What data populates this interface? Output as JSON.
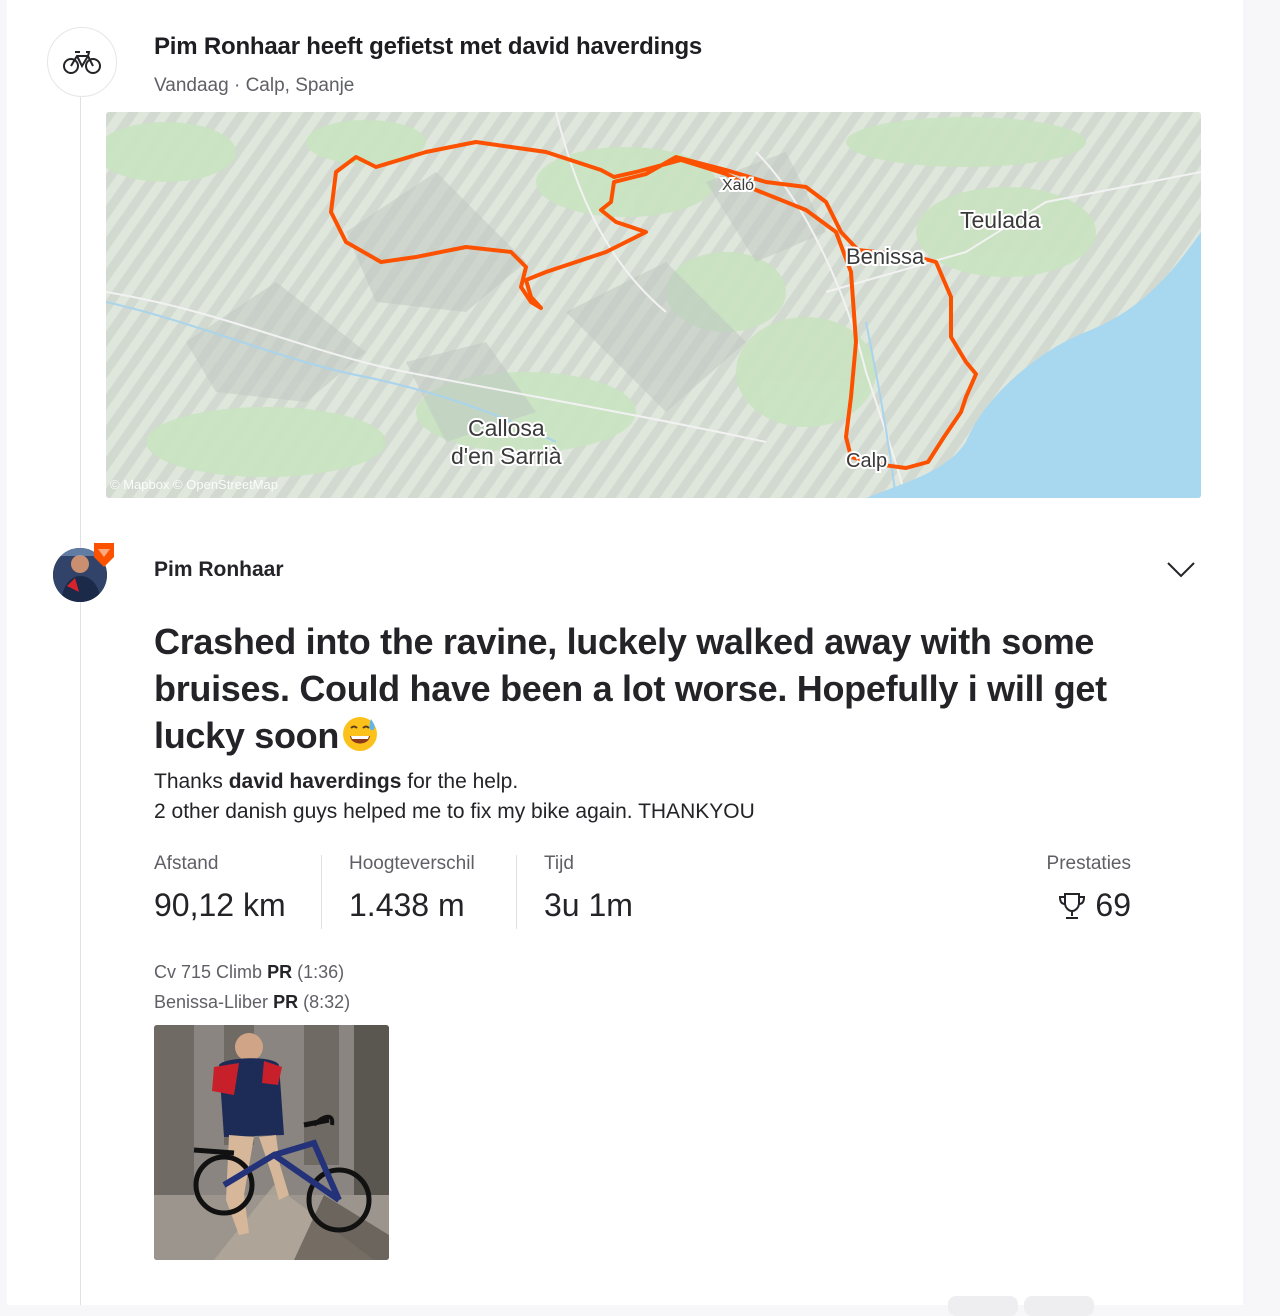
{
  "group_activity": {
    "icon": "bike-icon",
    "title": "Pim Ronhaar heeft gefietst met david haverdings",
    "date": "Vandaag",
    "separator": "·",
    "location": "Calp, Spanje"
  },
  "map": {
    "labels": {
      "teulada": "Teulada",
      "benissa": "Benissa",
      "xalo": "Xaló",
      "callosa_line1": "Callosa",
      "callosa_line2": "d'en Sarrià",
      "calp": "Calp"
    },
    "attribution": "© Mapbox © OpenStreetMap",
    "route_color": "#fc5200",
    "water_color": "#a8d7f0"
  },
  "activity": {
    "athlete_name": "Pim Ronhaar",
    "title": "Crashed into the ravine, luckely walked away with some bruises. Could have been a lot worse. Hopefully i will get lucky soon",
    "emoji": "grinning-sweat-emoji",
    "description": {
      "line1_prefix": "Thanks ",
      "mention": "david haverdings",
      "line1_suffix": " for the help.",
      "line2": "2 other danish guys helped me to fix my bike again. THANKYOU"
    },
    "stats": {
      "distance_label": "Afstand",
      "distance_value": "90,12 km",
      "elevation_label": "Hoogteverschil",
      "elevation_value": "1.438 m",
      "time_label": "Tijd",
      "time_value": "3u 1m",
      "achievements_label": "Prestaties",
      "achievements_value": "69"
    },
    "segments": [
      {
        "name": "Cv 715 Climb",
        "badge": "PR",
        "time": "(1:36)"
      },
      {
        "name": "Benissa-Lliber",
        "badge": "PR",
        "time": "(8:32)"
      }
    ]
  },
  "colors": {
    "accent": "#fc5200",
    "text": "#242428",
    "muted": "#5f5f66"
  }
}
